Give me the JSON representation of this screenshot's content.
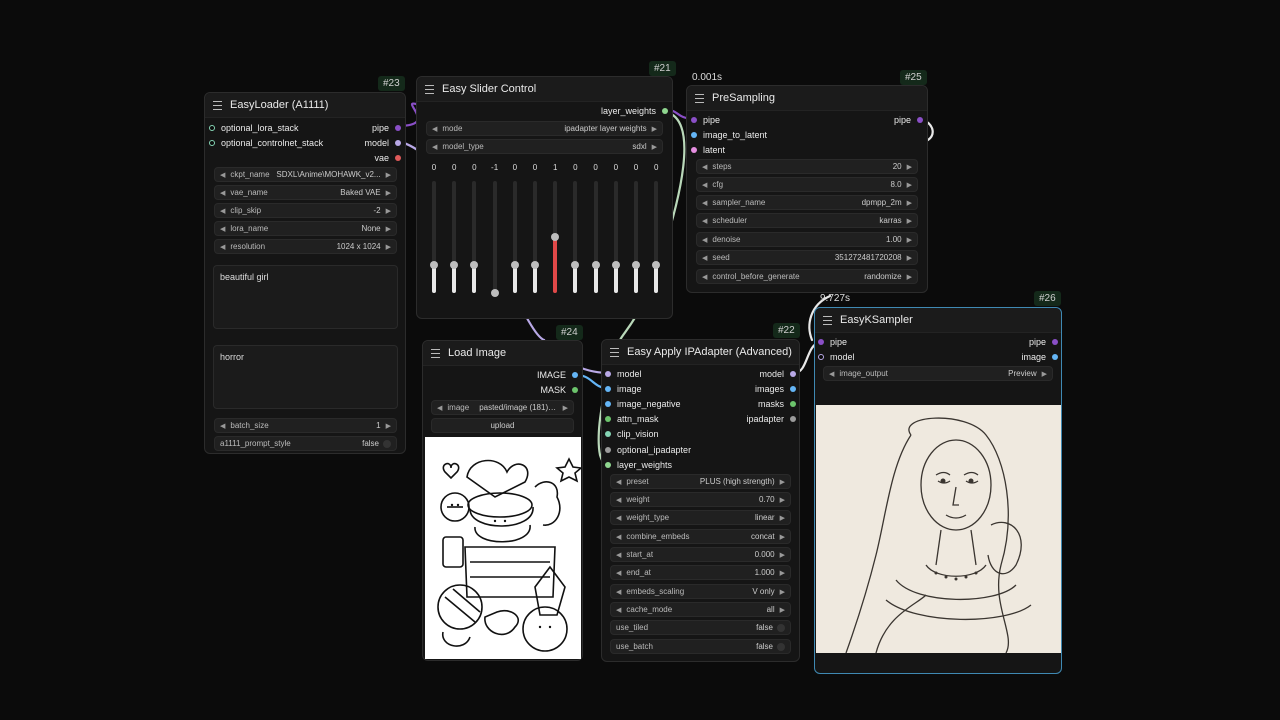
{
  "colors": {
    "pipe": "#8a4fc7",
    "model": "#b8a8e6",
    "vae": "#e05a5a",
    "image": "#64b5f6",
    "latent": "#e58ee0",
    "mask": "#6cc46c",
    "lora": "#85d4b4",
    "layer_weights": "#8fd68f",
    "generic": "#9b9b9b"
  },
  "loader": {
    "badge": "#23",
    "title": "EasyLoader (A1111)",
    "inputs": [
      "optional_lora_stack",
      "optional_controlnet_stack"
    ],
    "outputs": [
      "pipe",
      "model",
      "vae"
    ],
    "widgets": [
      {
        "label": "ckpt_name",
        "value": "SDXL\\Anime\\MOHAWK_v2..."
      },
      {
        "label": "vae_name",
        "value": "Baked VAE"
      },
      {
        "label": "clip_skip",
        "value": "-2"
      },
      {
        "label": "lora_name",
        "value": "None"
      },
      {
        "label": "resolution",
        "value": "1024 x 1024"
      }
    ],
    "positive": "beautiful girl",
    "negative": "horror",
    "batch_size": {
      "label": "batch_size",
      "value": "1"
    },
    "prompt_style": {
      "label": "a1111_prompt_style",
      "value": "false"
    }
  },
  "slider": {
    "badge": "#21",
    "title": "Easy Slider Control",
    "output": "layer_weights",
    "widgets": [
      {
        "label": "mode",
        "value": "ipadapter layer weights"
      },
      {
        "label": "model_type",
        "value": "sdxl"
      }
    ],
    "values": [
      "0",
      "0",
      "0",
      "-1",
      "0",
      "0",
      "1",
      "0",
      "0",
      "0",
      "0",
      "0"
    ],
    "levels": [
      0,
      0,
      0,
      -1,
      0,
      0,
      1,
      0,
      0,
      0,
      0,
      0
    ]
  },
  "presampling": {
    "timer": "0.001s",
    "badge": "#25",
    "title": "PreSampling",
    "inputs": [
      "pipe",
      "image_to_latent",
      "latent"
    ],
    "output": "pipe",
    "widgets": [
      {
        "label": "steps",
        "value": "20"
      },
      {
        "label": "cfg",
        "value": "8.0"
      },
      {
        "label": "sampler_name",
        "value": "dpmpp_2m"
      },
      {
        "label": "scheduler",
        "value": "karras"
      },
      {
        "label": "denoise",
        "value": "1.00"
      },
      {
        "label": "seed",
        "value": "351272481720208"
      },
      {
        "label": "control_before_generate",
        "value": "randomize"
      }
    ]
  },
  "loadimage": {
    "badge": "#24",
    "title": "Load Image",
    "outputs": [
      "IMAGE",
      "MASK"
    ],
    "image_widget": {
      "label": "image",
      "value": "pasted/image (181).p..."
    },
    "upload": "upload"
  },
  "ipadapter": {
    "badge": "#22",
    "title": "Easy Apply IPAdapter (Advanced)",
    "inputs": [
      "model",
      "image",
      "image_negative",
      "attn_mask",
      "clip_vision",
      "optional_ipadapter",
      "layer_weights"
    ],
    "outputs": [
      "model",
      "images",
      "masks",
      "ipadapter"
    ],
    "widgets": [
      {
        "label": "preset",
        "value": "PLUS (high strength)"
      },
      {
        "label": "weight",
        "value": "0.70"
      },
      {
        "label": "weight_type",
        "value": "linear"
      },
      {
        "label": "combine_embeds",
        "value": "concat"
      },
      {
        "label": "start_at",
        "value": "0.000"
      },
      {
        "label": "end_at",
        "value": "1.000"
      },
      {
        "label": "embeds_scaling",
        "value": "V only"
      },
      {
        "label": "cache_mode",
        "value": "all"
      }
    ],
    "toggles": [
      {
        "label": "use_tiled",
        "value": "false"
      },
      {
        "label": "use_batch",
        "value": "false"
      }
    ]
  },
  "ksampler": {
    "timer": "9.727s",
    "badge": "#26",
    "title": "EasyKSampler",
    "inputs": [
      "pipe",
      "model"
    ],
    "outputs": [
      "pipe",
      "image"
    ],
    "widget": {
      "label": "image_output",
      "value": "Preview"
    }
  }
}
